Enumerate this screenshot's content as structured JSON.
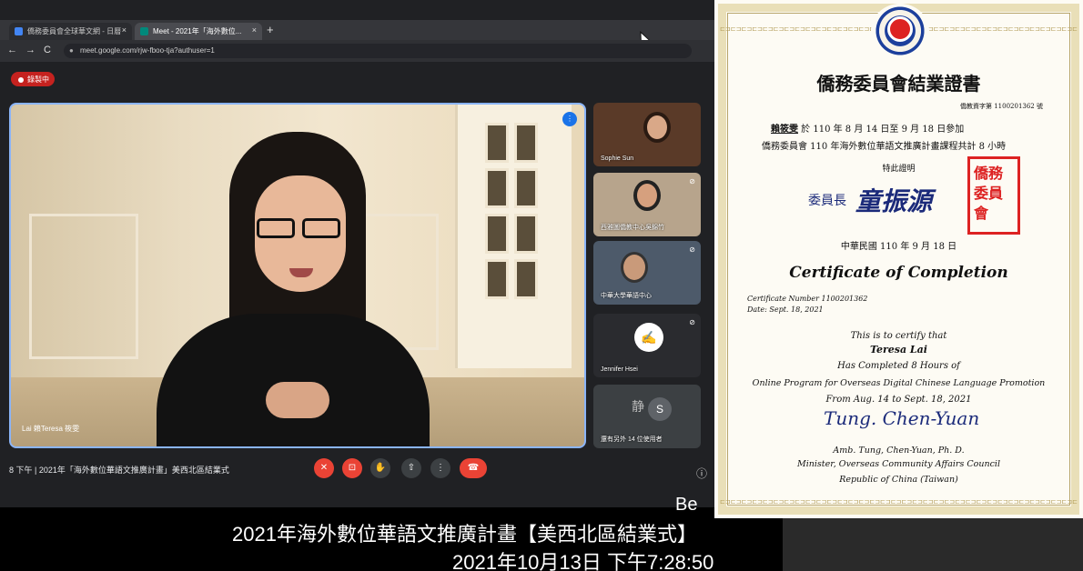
{
  "browser": {
    "tabs": [
      {
        "label": "僑務委員會全球華文網 - 日曆"
      },
      {
        "label": "Meet - 2021年「海外數位..."
      }
    ],
    "new_tab": "+",
    "url": "meet.google.com/rjw-fboo-tja?authuser=1"
  },
  "meet": {
    "recording": "錄製中",
    "main_tile_name": "Lai 賴Teresa 筱雯",
    "participants": [
      {
        "name": "Sophie Sun"
      },
      {
        "name": "西雅圖僑教中心吳錦竹"
      },
      {
        "name": "中華大學華語中心"
      },
      {
        "name": "Jennifer Hsei"
      },
      {
        "name": "還有另外 14 位使用者"
      }
    ],
    "others_initial": "S",
    "meeting_title": "8 下午 | 2021年「海外數位華語文推廣計畫」美西北區結業式"
  },
  "caption": {
    "bel": "Be",
    "line1": "2021年海外數位華語文推廣計畫【美西北區結業式】",
    "line2": "2021年10月13日 下午7:28:50"
  },
  "certificate": {
    "title_cn": "僑務委員會結業證書",
    "number_cn": "僑教資字第 1100201362 號",
    "line1_name": "賴筱雯",
    "line1_text": " 於 110 年 8 月 14 日至 9 月 18 日參加",
    "line2_text": "僑務委員會 110 年海外數位華語文推廣計畫課程共計 8 小時",
    "special_proof": "特此證明",
    "chair_label": "委員長",
    "chair_name": "童振源",
    "seal_text": "僑務委員會",
    "date_cn": "中華民國 110 年 9 月 18 日",
    "title_en": "Certificate of Completion",
    "number_en": "Certificate Number 1100201362",
    "date_en": "Date: Sept. 18, 2021",
    "certify": "This is to certify that",
    "recipient": "Teresa Lai",
    "completed": "Has Completed  8  Hours of",
    "program": "Online Program for Overseas Digital Chinese Language Promotion",
    "from": "From  Aug. 14 to Sept. 18, 2021",
    "signature": "Tung. Chen-Yuan",
    "signer": "Amb. Tung, Chen-Yuan, Ph. D.",
    "signer_title": "Minister, Overseas Community Affairs Council",
    "country": "Republic of China (Taiwan)"
  },
  "colors": {
    "record_red": "#c5221f",
    "meet_blue": "#8ab4f8",
    "seal_red": "#dd2222",
    "signature_blue": "#1b2a7a"
  }
}
